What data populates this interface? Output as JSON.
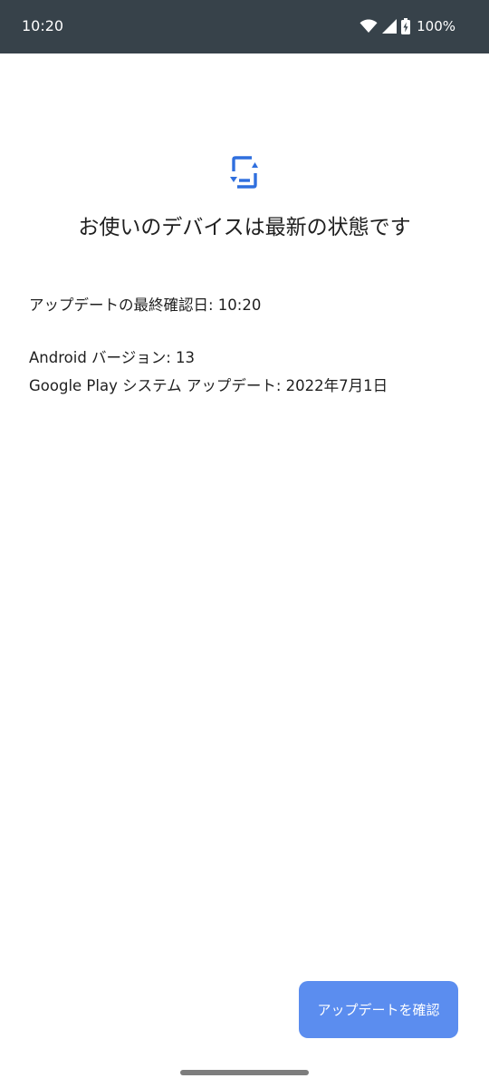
{
  "status_bar": {
    "time": "10:20",
    "battery_percent": "100%",
    "icons": [
      "wifi-icon",
      "cell-signal-icon",
      "battery-charging-icon"
    ],
    "background_color": "#37424a"
  },
  "main": {
    "hero_icon": "phone-sync-icon",
    "title": "お使いのデバイスは最新の状態です",
    "last_checked": "アップデートの最終確認日: 10:20",
    "android_version": "Android バージョン: 13",
    "play_system_update": "Google Play システム アップデート: 2022年7月1日"
  },
  "actions": {
    "check_update_label": "アップデートを確認",
    "button_color": "#5b8def",
    "accent_color": "#2f6fde"
  }
}
